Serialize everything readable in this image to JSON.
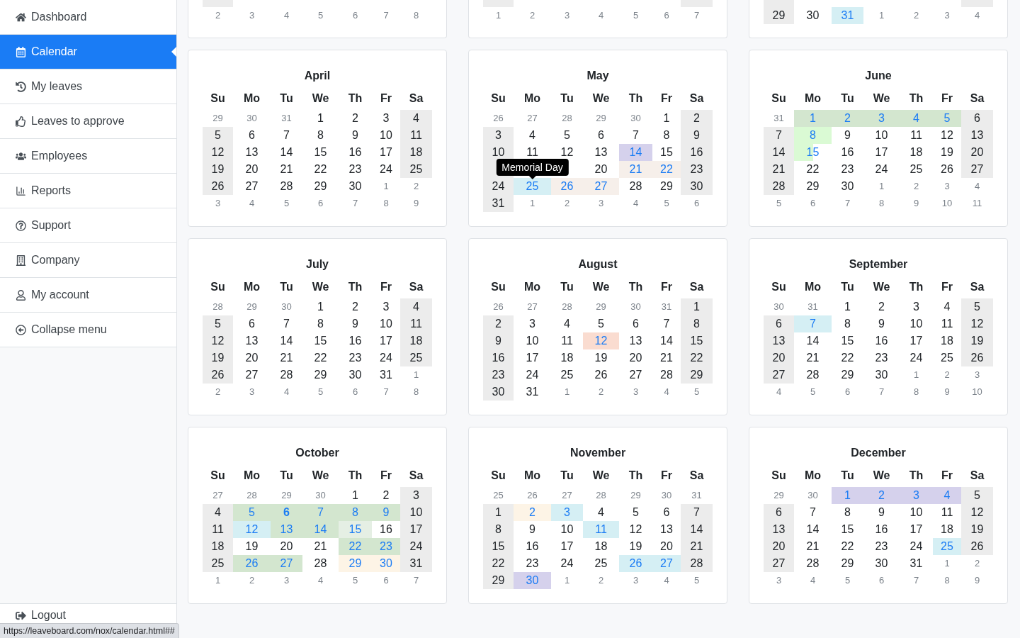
{
  "sidebar": {
    "items": [
      {
        "label": "Dashboard",
        "selected": false
      },
      {
        "label": "Calendar",
        "selected": true
      },
      {
        "label": "My leaves",
        "selected": false
      },
      {
        "label": "Leaves to approve",
        "selected": false
      },
      {
        "label": "Employees",
        "selected": false
      },
      {
        "label": "Reports",
        "selected": false
      },
      {
        "label": "Support",
        "selected": false
      },
      {
        "label": "Company",
        "selected": false
      },
      {
        "label": "My account",
        "selected": false
      },
      {
        "label": "Collapse menu",
        "selected": false
      }
    ],
    "footer": {
      "label": "Logout"
    }
  },
  "partial_months": [
    {
      "clipped_week": [
        {
          "kind": "weekend"
        },
        {
          "kind": "day"
        },
        {
          "kind": "day"
        },
        {
          "kind": "day"
        },
        {
          "kind": "day"
        },
        {
          "kind": "day"
        },
        {
          "kind": "other_month"
        }
      ],
      "weeks": [
        [
          {
            "day": "2",
            "kind": "other_month"
          },
          {
            "day": "3",
            "kind": "other_month"
          },
          {
            "day": "4",
            "kind": "other_month"
          },
          {
            "day": "5",
            "kind": "other_month"
          },
          {
            "day": "6",
            "kind": "other_month"
          },
          {
            "day": "7",
            "kind": "other_month"
          },
          {
            "day": "8",
            "kind": "other_month"
          }
        ]
      ]
    },
    {
      "clipped_week": [
        {
          "kind": "weekend"
        },
        {
          "kind": "day"
        },
        {
          "kind": "day"
        },
        {
          "kind": "day"
        },
        {
          "kind": "day"
        },
        {
          "kind": "day"
        },
        {
          "kind": "weekend"
        }
      ],
      "weeks": [
        [
          {
            "day": "1",
            "kind": "other_month"
          },
          {
            "day": "2",
            "kind": "other_month"
          },
          {
            "day": "3",
            "kind": "other_month"
          },
          {
            "day": "4",
            "kind": "other_month"
          },
          {
            "day": "5",
            "kind": "other_month"
          },
          {
            "day": "6",
            "kind": "other_month"
          },
          {
            "day": "7",
            "kind": "other_month"
          }
        ]
      ]
    },
    {
      "clipped_week": [
        {
          "kind": "weekend"
        },
        {
          "kind": "day"
        },
        {
          "kind": "day"
        },
        {
          "kind": "day"
        },
        {
          "kind": "day"
        },
        {
          "kind": "day"
        },
        {
          "kind": "weekend"
        }
      ],
      "weeks": [
        [
          {
            "day": "29",
            "kind": "weekend"
          },
          {
            "day": "30",
            "kind": "day"
          },
          {
            "day": "31",
            "kind": "leave",
            "color": "#d5eff4"
          },
          {
            "day": "1",
            "kind": "other_month"
          },
          {
            "day": "2",
            "kind": "other_month"
          },
          {
            "day": "3",
            "kind": "other_month"
          },
          {
            "day": "4",
            "kind": "other_month"
          }
        ]
      ]
    }
  ],
  "months": [
    {
      "title": "April",
      "weekdays": [
        "Su",
        "Mo",
        "Tu",
        "We",
        "Th",
        "Fr",
        "Sa"
      ],
      "weeks": [
        [
          {
            "day": "29",
            "kind": "other_month"
          },
          {
            "day": "30",
            "kind": "other_month"
          },
          {
            "day": "31",
            "kind": "other_month"
          },
          {
            "day": "1",
            "kind": "day"
          },
          {
            "day": "2",
            "kind": "day"
          },
          {
            "day": "3",
            "kind": "day"
          },
          {
            "day": "4",
            "kind": "weekend"
          }
        ],
        [
          {
            "day": "5",
            "kind": "weekend"
          },
          {
            "day": "6",
            "kind": "day"
          },
          {
            "day": "7",
            "kind": "day"
          },
          {
            "day": "8",
            "kind": "day"
          },
          {
            "day": "9",
            "kind": "day"
          },
          {
            "day": "10",
            "kind": "day"
          },
          {
            "day": "11",
            "kind": "weekend"
          }
        ],
        [
          {
            "day": "12",
            "kind": "weekend"
          },
          {
            "day": "13",
            "kind": "day"
          },
          {
            "day": "14",
            "kind": "day"
          },
          {
            "day": "15",
            "kind": "day"
          },
          {
            "day": "16",
            "kind": "day"
          },
          {
            "day": "17",
            "kind": "day"
          },
          {
            "day": "18",
            "kind": "weekend"
          }
        ],
        [
          {
            "day": "19",
            "kind": "weekend"
          },
          {
            "day": "20",
            "kind": "day"
          },
          {
            "day": "21",
            "kind": "day"
          },
          {
            "day": "22",
            "kind": "day"
          },
          {
            "day": "23",
            "kind": "day"
          },
          {
            "day": "24",
            "kind": "day"
          },
          {
            "day": "25",
            "kind": "weekend"
          }
        ],
        [
          {
            "day": "26",
            "kind": "weekend"
          },
          {
            "day": "27",
            "kind": "day"
          },
          {
            "day": "28",
            "kind": "day"
          },
          {
            "day": "29",
            "kind": "day"
          },
          {
            "day": "30",
            "kind": "day"
          },
          {
            "day": "1",
            "kind": "other_month"
          },
          {
            "day": "2",
            "kind": "other_month"
          }
        ],
        [
          {
            "day": "3",
            "kind": "other_month"
          },
          {
            "day": "4",
            "kind": "other_month"
          },
          {
            "day": "5",
            "kind": "other_month"
          },
          {
            "day": "6",
            "kind": "other_month"
          },
          {
            "day": "7",
            "kind": "other_month"
          },
          {
            "day": "8",
            "kind": "other_month"
          },
          {
            "day": "9",
            "kind": "other_month"
          }
        ]
      ]
    },
    {
      "title": "May",
      "weekdays": [
        "Su",
        "Mo",
        "Tu",
        "We",
        "Th",
        "Fr",
        "Sa"
      ],
      "weeks": [
        [
          {
            "day": "26",
            "kind": "other_month"
          },
          {
            "day": "27",
            "kind": "other_month"
          },
          {
            "day": "28",
            "kind": "other_month"
          },
          {
            "day": "29",
            "kind": "other_month"
          },
          {
            "day": "30",
            "kind": "other_month"
          },
          {
            "day": "1",
            "kind": "day"
          },
          {
            "day": "2",
            "kind": "weekend"
          }
        ],
        [
          {
            "day": "3",
            "kind": "weekend"
          },
          {
            "day": "4",
            "kind": "day"
          },
          {
            "day": "5",
            "kind": "day"
          },
          {
            "day": "6",
            "kind": "day"
          },
          {
            "day": "7",
            "kind": "day"
          },
          {
            "day": "8",
            "kind": "day"
          },
          {
            "day": "9",
            "kind": "weekend"
          }
        ],
        [
          {
            "day": "10",
            "kind": "weekend"
          },
          {
            "day": "11",
            "kind": "day"
          },
          {
            "day": "12",
            "kind": "day"
          },
          {
            "day": "13",
            "kind": "day"
          },
          {
            "day": "14",
            "kind": "leave",
            "color": "#d5d1ec"
          },
          {
            "day": "15",
            "kind": "day"
          },
          {
            "day": "16",
            "kind": "weekend"
          }
        ],
        [
          {
            "kind": "weekend"
          },
          {
            "kind": "day"
          },
          {
            "kind": "day"
          },
          {
            "day": "20",
            "kind": "day"
          },
          {
            "day": "21",
            "kind": "leave",
            "color": "#f6efea"
          },
          {
            "day": "22",
            "kind": "leave",
            "color": "#f6efea"
          },
          {
            "day": "23",
            "kind": "weekend"
          }
        ],
        [
          {
            "day": "24",
            "kind": "weekend"
          },
          {
            "day": "25",
            "kind": "leave",
            "color": "#d5eff4",
            "tooltip": "Memorial Day"
          },
          {
            "day": "26",
            "kind": "leave",
            "color": "#f6efea"
          },
          {
            "day": "27",
            "kind": "leave",
            "color": "#f6efea"
          },
          {
            "day": "28",
            "kind": "day"
          },
          {
            "day": "29",
            "kind": "day"
          },
          {
            "day": "30",
            "kind": "weekend"
          }
        ],
        [
          {
            "day": "31",
            "kind": "weekend"
          },
          {
            "day": "1",
            "kind": "other_month"
          },
          {
            "day": "2",
            "kind": "other_month"
          },
          {
            "day": "3",
            "kind": "other_month"
          },
          {
            "day": "4",
            "kind": "other_month"
          },
          {
            "day": "5",
            "kind": "other_month"
          },
          {
            "day": "6",
            "kind": "other_month"
          }
        ]
      ]
    },
    {
      "title": "June",
      "weekdays": [
        "Su",
        "Mo",
        "Tu",
        "We",
        "Th",
        "Fr",
        "Sa"
      ],
      "weeks": [
        [
          {
            "day": "31",
            "kind": "other_month"
          },
          {
            "day": "1",
            "kind": "leave",
            "color": "#d3e6cf"
          },
          {
            "day": "2",
            "kind": "leave",
            "color": "#d3e6cf"
          },
          {
            "day": "3",
            "kind": "leave",
            "color": "#d3e6cf"
          },
          {
            "day": "4",
            "kind": "leave",
            "color": "#d3e6cf"
          },
          {
            "day": "5",
            "kind": "leave",
            "color": "#d3e6cf"
          },
          {
            "day": "6",
            "kind": "weekend"
          }
        ],
        [
          {
            "day": "7",
            "kind": "weekend"
          },
          {
            "day": "8",
            "kind": "leave",
            "color": "#dafad4"
          },
          {
            "day": "9",
            "kind": "day"
          },
          {
            "day": "10",
            "kind": "day"
          },
          {
            "day": "11",
            "kind": "day"
          },
          {
            "day": "12",
            "kind": "day"
          },
          {
            "day": "13",
            "kind": "weekend"
          }
        ],
        [
          {
            "day": "14",
            "kind": "weekend"
          },
          {
            "day": "15",
            "kind": "half_day",
            "color": "#dafad4"
          },
          {
            "day": "16",
            "kind": "day"
          },
          {
            "day": "17",
            "kind": "day"
          },
          {
            "day": "18",
            "kind": "day"
          },
          {
            "day": "19",
            "kind": "day"
          },
          {
            "day": "20",
            "kind": "weekend"
          }
        ],
        [
          {
            "day": "21",
            "kind": "weekend"
          },
          {
            "day": "22",
            "kind": "day"
          },
          {
            "day": "23",
            "kind": "day"
          },
          {
            "day": "24",
            "kind": "day"
          },
          {
            "day": "25",
            "kind": "day"
          },
          {
            "day": "26",
            "kind": "day"
          },
          {
            "day": "27",
            "kind": "weekend"
          }
        ],
        [
          {
            "day": "28",
            "kind": "weekend"
          },
          {
            "day": "29",
            "kind": "day"
          },
          {
            "day": "30",
            "kind": "day"
          },
          {
            "day": "1",
            "kind": "other_month"
          },
          {
            "day": "2",
            "kind": "other_month"
          },
          {
            "day": "3",
            "kind": "other_month"
          },
          {
            "day": "4",
            "kind": "other_month"
          }
        ],
        [
          {
            "day": "5",
            "kind": "other_month"
          },
          {
            "day": "6",
            "kind": "other_month"
          },
          {
            "day": "7",
            "kind": "other_month"
          },
          {
            "day": "8",
            "kind": "other_month"
          },
          {
            "day": "9",
            "kind": "other_month"
          },
          {
            "day": "10",
            "kind": "other_month"
          },
          {
            "day": "11",
            "kind": "other_month"
          }
        ]
      ]
    },
    {
      "title": "July",
      "weekdays": [
        "Su",
        "Mo",
        "Tu",
        "We",
        "Th",
        "Fr",
        "Sa"
      ],
      "weeks": [
        [
          {
            "day": "28",
            "kind": "other_month"
          },
          {
            "day": "29",
            "kind": "other_month"
          },
          {
            "day": "30",
            "kind": "other_month"
          },
          {
            "day": "1",
            "kind": "day"
          },
          {
            "day": "2",
            "kind": "day"
          },
          {
            "day": "3",
            "kind": "day"
          },
          {
            "day": "4",
            "kind": "weekend"
          }
        ],
        [
          {
            "day": "5",
            "kind": "weekend"
          },
          {
            "day": "6",
            "kind": "day"
          },
          {
            "day": "7",
            "kind": "day"
          },
          {
            "day": "8",
            "kind": "day"
          },
          {
            "day": "9",
            "kind": "day"
          },
          {
            "day": "10",
            "kind": "day"
          },
          {
            "day": "11",
            "kind": "weekend"
          }
        ],
        [
          {
            "day": "12",
            "kind": "weekend"
          },
          {
            "day": "13",
            "kind": "day"
          },
          {
            "day": "14",
            "kind": "day"
          },
          {
            "day": "15",
            "kind": "day"
          },
          {
            "day": "16",
            "kind": "day"
          },
          {
            "day": "17",
            "kind": "day"
          },
          {
            "day": "18",
            "kind": "weekend"
          }
        ],
        [
          {
            "day": "19",
            "kind": "weekend"
          },
          {
            "day": "20",
            "kind": "day"
          },
          {
            "day": "21",
            "kind": "day"
          },
          {
            "day": "22",
            "kind": "day"
          },
          {
            "day": "23",
            "kind": "day"
          },
          {
            "day": "24",
            "kind": "day"
          },
          {
            "day": "25",
            "kind": "weekend"
          }
        ],
        [
          {
            "day": "26",
            "kind": "weekend"
          },
          {
            "day": "27",
            "kind": "day"
          },
          {
            "day": "28",
            "kind": "day"
          },
          {
            "day": "29",
            "kind": "day"
          },
          {
            "day": "30",
            "kind": "day"
          },
          {
            "day": "31",
            "kind": "day"
          },
          {
            "day": "1",
            "kind": "other_month"
          }
        ],
        [
          {
            "day": "2",
            "kind": "other_month"
          },
          {
            "day": "3",
            "kind": "other_month"
          },
          {
            "day": "4",
            "kind": "other_month"
          },
          {
            "day": "5",
            "kind": "other_month"
          },
          {
            "day": "6",
            "kind": "other_month"
          },
          {
            "day": "7",
            "kind": "other_month"
          },
          {
            "day": "8",
            "kind": "other_month"
          }
        ]
      ]
    },
    {
      "title": "August",
      "weekdays": [
        "Su",
        "Mo",
        "Tu",
        "We",
        "Th",
        "Fr",
        "Sa"
      ],
      "weeks": [
        [
          {
            "day": "26",
            "kind": "other_month"
          },
          {
            "day": "27",
            "kind": "other_month"
          },
          {
            "day": "28",
            "kind": "other_month"
          },
          {
            "day": "29",
            "kind": "other_month"
          },
          {
            "day": "30",
            "kind": "other_month"
          },
          {
            "day": "31",
            "kind": "other_month"
          },
          {
            "day": "1",
            "kind": "weekend"
          }
        ],
        [
          {
            "day": "2",
            "kind": "weekend"
          },
          {
            "day": "3",
            "kind": "day"
          },
          {
            "day": "4",
            "kind": "day"
          },
          {
            "day": "5",
            "kind": "day"
          },
          {
            "day": "6",
            "kind": "day"
          },
          {
            "day": "7",
            "kind": "day"
          },
          {
            "day": "8",
            "kind": "weekend"
          }
        ],
        [
          {
            "day": "9",
            "kind": "weekend"
          },
          {
            "day": "10",
            "kind": "day"
          },
          {
            "day": "11",
            "kind": "day"
          },
          {
            "day": "12",
            "kind": "leave",
            "color": "#fadcd0"
          },
          {
            "day": "13",
            "kind": "day"
          },
          {
            "day": "14",
            "kind": "day"
          },
          {
            "day": "15",
            "kind": "weekend"
          }
        ],
        [
          {
            "day": "16",
            "kind": "weekend"
          },
          {
            "day": "17",
            "kind": "day"
          },
          {
            "day": "18",
            "kind": "day"
          },
          {
            "day": "19",
            "kind": "day"
          },
          {
            "day": "20",
            "kind": "day"
          },
          {
            "day": "21",
            "kind": "day"
          },
          {
            "day": "22",
            "kind": "weekend"
          }
        ],
        [
          {
            "day": "23",
            "kind": "weekend"
          },
          {
            "day": "24",
            "kind": "day"
          },
          {
            "day": "25",
            "kind": "day"
          },
          {
            "day": "26",
            "kind": "day"
          },
          {
            "day": "27",
            "kind": "day"
          },
          {
            "day": "28",
            "kind": "day"
          },
          {
            "day": "29",
            "kind": "weekend"
          }
        ],
        [
          {
            "day": "30",
            "kind": "weekend"
          },
          {
            "day": "31",
            "kind": "day"
          },
          {
            "day": "1",
            "kind": "other_month"
          },
          {
            "day": "2",
            "kind": "other_month"
          },
          {
            "day": "3",
            "kind": "other_month"
          },
          {
            "day": "4",
            "kind": "other_month"
          },
          {
            "day": "5",
            "kind": "other_month"
          }
        ]
      ]
    },
    {
      "title": "September",
      "weekdays": [
        "Su",
        "Mo",
        "Tu",
        "We",
        "Th",
        "Fr",
        "Sa"
      ],
      "weeks": [
        [
          {
            "day": "30",
            "kind": "other_month"
          },
          {
            "day": "31",
            "kind": "other_month"
          },
          {
            "day": "1",
            "kind": "day"
          },
          {
            "day": "2",
            "kind": "day"
          },
          {
            "day": "3",
            "kind": "day"
          },
          {
            "day": "4",
            "kind": "day"
          },
          {
            "day": "5",
            "kind": "weekend"
          }
        ],
        [
          {
            "day": "6",
            "kind": "weekend"
          },
          {
            "day": "7",
            "kind": "leave",
            "color": "#d5eff4"
          },
          {
            "day": "8",
            "kind": "day"
          },
          {
            "day": "9",
            "kind": "day"
          },
          {
            "day": "10",
            "kind": "day"
          },
          {
            "day": "11",
            "kind": "day"
          },
          {
            "day": "12",
            "kind": "weekend"
          }
        ],
        [
          {
            "day": "13",
            "kind": "weekend"
          },
          {
            "day": "14",
            "kind": "day"
          },
          {
            "day": "15",
            "kind": "day"
          },
          {
            "day": "16",
            "kind": "day"
          },
          {
            "day": "17",
            "kind": "day"
          },
          {
            "day": "18",
            "kind": "day"
          },
          {
            "day": "19",
            "kind": "weekend"
          }
        ],
        [
          {
            "day": "20",
            "kind": "weekend"
          },
          {
            "day": "21",
            "kind": "day"
          },
          {
            "day": "22",
            "kind": "day"
          },
          {
            "day": "23",
            "kind": "day"
          },
          {
            "day": "24",
            "kind": "day"
          },
          {
            "day": "25",
            "kind": "day"
          },
          {
            "day": "26",
            "kind": "weekend"
          }
        ],
        [
          {
            "day": "27",
            "kind": "weekend"
          },
          {
            "day": "28",
            "kind": "day"
          },
          {
            "day": "29",
            "kind": "day"
          },
          {
            "day": "30",
            "kind": "day"
          },
          {
            "day": "1",
            "kind": "other_month"
          },
          {
            "day": "2",
            "kind": "other_month"
          },
          {
            "day": "3",
            "kind": "other_month"
          }
        ],
        [
          {
            "day": "4",
            "kind": "other_month"
          },
          {
            "day": "5",
            "kind": "other_month"
          },
          {
            "day": "6",
            "kind": "other_month"
          },
          {
            "day": "7",
            "kind": "other_month"
          },
          {
            "day": "8",
            "kind": "other_month"
          },
          {
            "day": "9",
            "kind": "other_month"
          },
          {
            "day": "10",
            "kind": "other_month"
          }
        ]
      ]
    },
    {
      "title": "October",
      "weekdays": [
        "Su",
        "Mo",
        "Tu",
        "We",
        "Th",
        "Fr",
        "Sa"
      ],
      "weeks": [
        [
          {
            "day": "27",
            "kind": "other_month"
          },
          {
            "day": "28",
            "kind": "other_month"
          },
          {
            "day": "29",
            "kind": "other_month"
          },
          {
            "day": "30",
            "kind": "other_month"
          },
          {
            "day": "1",
            "kind": "day"
          },
          {
            "day": "2",
            "kind": "day"
          },
          {
            "day": "3",
            "kind": "weekend"
          }
        ],
        [
          {
            "day": "4",
            "kind": "weekend"
          },
          {
            "day": "5",
            "kind": "leave",
            "color": "#d3e6cf"
          },
          {
            "day": "6",
            "kind": "today",
            "color": "#d3e6cf"
          },
          {
            "day": "7",
            "kind": "leave",
            "color": "#d3e6cf"
          },
          {
            "day": "8",
            "kind": "leave",
            "color": "#d3e6cf"
          },
          {
            "day": "9",
            "kind": "leave",
            "color": "#d3e6cf"
          },
          {
            "day": "10",
            "kind": "weekend"
          }
        ],
        [
          {
            "day": "11",
            "kind": "weekend"
          },
          {
            "day": "12",
            "kind": "leave",
            "color": "#d5eff4"
          },
          {
            "day": "13",
            "kind": "leave",
            "color": "#d3e6cf"
          },
          {
            "day": "14",
            "kind": "leave",
            "color": "#d3e6cf"
          },
          {
            "day": "15",
            "kind": "leave",
            "color": "#e5efe4"
          },
          {
            "day": "16",
            "kind": "day"
          },
          {
            "day": "17",
            "kind": "weekend"
          }
        ],
        [
          {
            "day": "18",
            "kind": "weekend"
          },
          {
            "day": "19",
            "kind": "day"
          },
          {
            "day": "20",
            "kind": "day"
          },
          {
            "day": "21",
            "kind": "day"
          },
          {
            "day": "22",
            "kind": "leave",
            "color": "#d3e6cf"
          },
          {
            "day": "23",
            "kind": "leave",
            "color": "#d3e6cf"
          },
          {
            "day": "24",
            "kind": "weekend"
          }
        ],
        [
          {
            "day": "25",
            "kind": "weekend"
          },
          {
            "day": "26",
            "kind": "leave",
            "color": "#d3e6cf"
          },
          {
            "day": "27",
            "kind": "leave",
            "color": "#d3e6cf"
          },
          {
            "day": "28",
            "kind": "day"
          },
          {
            "day": "29",
            "kind": "leave",
            "color": "#fdf4e6"
          },
          {
            "day": "30",
            "kind": "leave",
            "color": "#fdf4e6"
          },
          {
            "day": "31",
            "kind": "weekend"
          }
        ],
        [
          {
            "day": "1",
            "kind": "other_month"
          },
          {
            "day": "2",
            "kind": "other_month"
          },
          {
            "day": "3",
            "kind": "other_month"
          },
          {
            "day": "4",
            "kind": "other_month"
          },
          {
            "day": "5",
            "kind": "other_month"
          },
          {
            "day": "6",
            "kind": "other_month"
          },
          {
            "day": "7",
            "kind": "other_month"
          }
        ]
      ]
    },
    {
      "title": "November",
      "weekdays": [
        "Su",
        "Mo",
        "Tu",
        "We",
        "Th",
        "Fr",
        "Sa"
      ],
      "weeks": [
        [
          {
            "day": "25",
            "kind": "other_month"
          },
          {
            "day": "26",
            "kind": "other_month"
          },
          {
            "day": "27",
            "kind": "other_month"
          },
          {
            "day": "28",
            "kind": "other_month"
          },
          {
            "day": "29",
            "kind": "other_month"
          },
          {
            "day": "30",
            "kind": "other_month"
          },
          {
            "day": "31",
            "kind": "other_month"
          }
        ],
        [
          {
            "day": "1",
            "kind": "weekend"
          },
          {
            "day": "2",
            "kind": "leave",
            "color": "#fdf4e6"
          },
          {
            "day": "3",
            "kind": "leave",
            "color": "#d5eff4"
          },
          {
            "day": "4",
            "kind": "day"
          },
          {
            "day": "5",
            "kind": "day"
          },
          {
            "day": "6",
            "kind": "day"
          },
          {
            "day": "7",
            "kind": "weekend"
          }
        ],
        [
          {
            "day": "8",
            "kind": "weekend"
          },
          {
            "day": "9",
            "kind": "day"
          },
          {
            "day": "10",
            "kind": "day"
          },
          {
            "day": "11",
            "kind": "leave",
            "color": "#d5eff4"
          },
          {
            "day": "12",
            "kind": "day"
          },
          {
            "day": "13",
            "kind": "day"
          },
          {
            "day": "14",
            "kind": "weekend"
          }
        ],
        [
          {
            "day": "15",
            "kind": "weekend"
          },
          {
            "day": "16",
            "kind": "day"
          },
          {
            "day": "17",
            "kind": "day"
          },
          {
            "day": "18",
            "kind": "day"
          },
          {
            "day": "19",
            "kind": "day"
          },
          {
            "day": "20",
            "kind": "day"
          },
          {
            "day": "21",
            "kind": "weekend"
          }
        ],
        [
          {
            "day": "22",
            "kind": "weekend"
          },
          {
            "day": "23",
            "kind": "day"
          },
          {
            "day": "24",
            "kind": "day"
          },
          {
            "day": "25",
            "kind": "day"
          },
          {
            "day": "26",
            "kind": "leave",
            "color": "#d5eff4"
          },
          {
            "day": "27",
            "kind": "leave",
            "color": "#d5eff4"
          },
          {
            "day": "28",
            "kind": "weekend"
          }
        ],
        [
          {
            "day": "29",
            "kind": "weekend"
          },
          {
            "day": "30",
            "kind": "leave",
            "color": "#d5d1ec"
          },
          {
            "day": "1",
            "kind": "other_month"
          },
          {
            "day": "2",
            "kind": "other_month"
          },
          {
            "day": "3",
            "kind": "other_month"
          },
          {
            "day": "4",
            "kind": "other_month"
          },
          {
            "day": "5",
            "kind": "other_month"
          }
        ]
      ]
    },
    {
      "title": "December",
      "weekdays": [
        "Su",
        "Mo",
        "Tu",
        "We",
        "Th",
        "Fr",
        "Sa"
      ],
      "weeks": [
        [
          {
            "day": "29",
            "kind": "other_month"
          },
          {
            "day": "30",
            "kind": "other_month"
          },
          {
            "day": "1",
            "kind": "leave",
            "color": "#d5d1ec"
          },
          {
            "day": "2",
            "kind": "leave",
            "color": "#d5d1ec"
          },
          {
            "day": "3",
            "kind": "leave",
            "color": "#d5d1ec"
          },
          {
            "day": "4",
            "kind": "leave",
            "color": "#d5d1ec"
          },
          {
            "day": "5",
            "kind": "weekend"
          }
        ],
        [
          {
            "day": "6",
            "kind": "weekend"
          },
          {
            "day": "7",
            "kind": "day"
          },
          {
            "day": "8",
            "kind": "day"
          },
          {
            "day": "9",
            "kind": "day"
          },
          {
            "day": "10",
            "kind": "day"
          },
          {
            "day": "11",
            "kind": "day"
          },
          {
            "day": "12",
            "kind": "weekend"
          }
        ],
        [
          {
            "day": "13",
            "kind": "weekend"
          },
          {
            "day": "14",
            "kind": "day"
          },
          {
            "day": "15",
            "kind": "day"
          },
          {
            "day": "16",
            "kind": "day"
          },
          {
            "day": "17",
            "kind": "day"
          },
          {
            "day": "18",
            "kind": "day"
          },
          {
            "day": "19",
            "kind": "weekend"
          }
        ],
        [
          {
            "day": "20",
            "kind": "weekend"
          },
          {
            "day": "21",
            "kind": "day"
          },
          {
            "day": "22",
            "kind": "day"
          },
          {
            "day": "23",
            "kind": "day"
          },
          {
            "day": "24",
            "kind": "day"
          },
          {
            "day": "25",
            "kind": "leave",
            "color": "#d5eff4"
          },
          {
            "day": "26",
            "kind": "weekend"
          }
        ],
        [
          {
            "day": "27",
            "kind": "weekend"
          },
          {
            "day": "28",
            "kind": "day"
          },
          {
            "day": "29",
            "kind": "day"
          },
          {
            "day": "30",
            "kind": "day"
          },
          {
            "day": "31",
            "kind": "day"
          },
          {
            "day": "1",
            "kind": "other_month"
          },
          {
            "day": "2",
            "kind": "other_month"
          }
        ],
        [
          {
            "day": "3",
            "kind": "other_month"
          },
          {
            "day": "4",
            "kind": "other_month"
          },
          {
            "day": "5",
            "kind": "other_month"
          },
          {
            "day": "6",
            "kind": "other_month"
          },
          {
            "day": "7",
            "kind": "other_month"
          },
          {
            "day": "8",
            "kind": "other_month"
          },
          {
            "day": "9",
            "kind": "other_month"
          }
        ]
      ]
    }
  ],
  "status_bar": {
    "url": "https://leaveboard.com/nox/calendar.html##"
  }
}
